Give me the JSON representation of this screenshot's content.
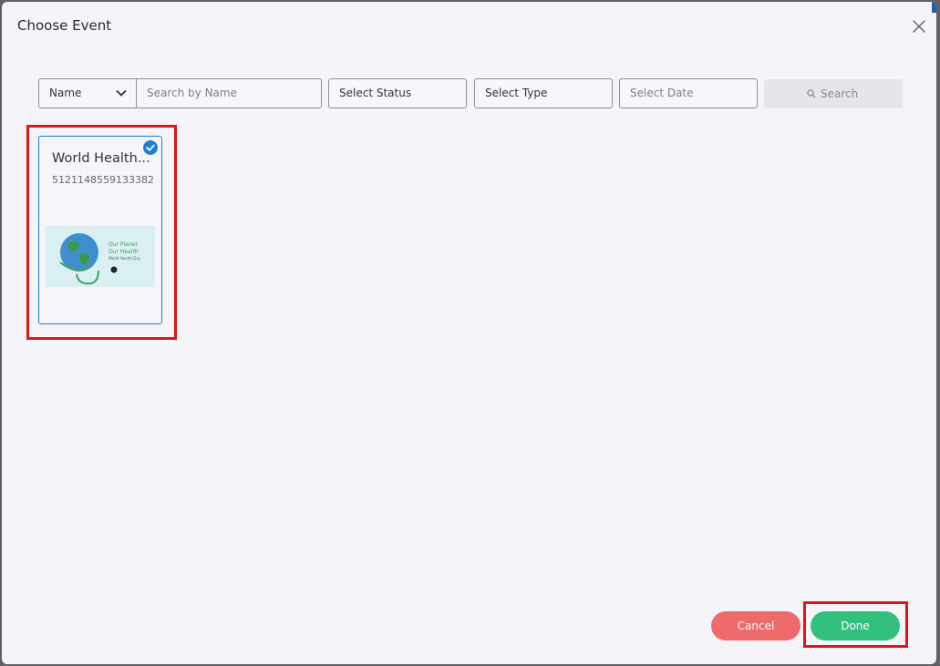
{
  "dialog": {
    "title": "Choose Event"
  },
  "filters": {
    "field_select_value": "Name",
    "name_placeholder": "Search by Name",
    "status_placeholder": "Select Status",
    "type_placeholder": "Select Type",
    "date_placeholder": "Select Date",
    "search_label": "Search"
  },
  "events": [
    {
      "title": "World Health...",
      "id": "5121148559133382",
      "selected": true,
      "image_text": [
        "Our Planet",
        "Our Health",
        "World Health Day"
      ]
    }
  ],
  "footer": {
    "cancel_label": "Cancel",
    "done_label": "Done"
  },
  "colors": {
    "accent_blue": "#1f7fd6",
    "cancel": "#ef6a6a",
    "done": "#33c07f",
    "highlight": "#e01515"
  }
}
